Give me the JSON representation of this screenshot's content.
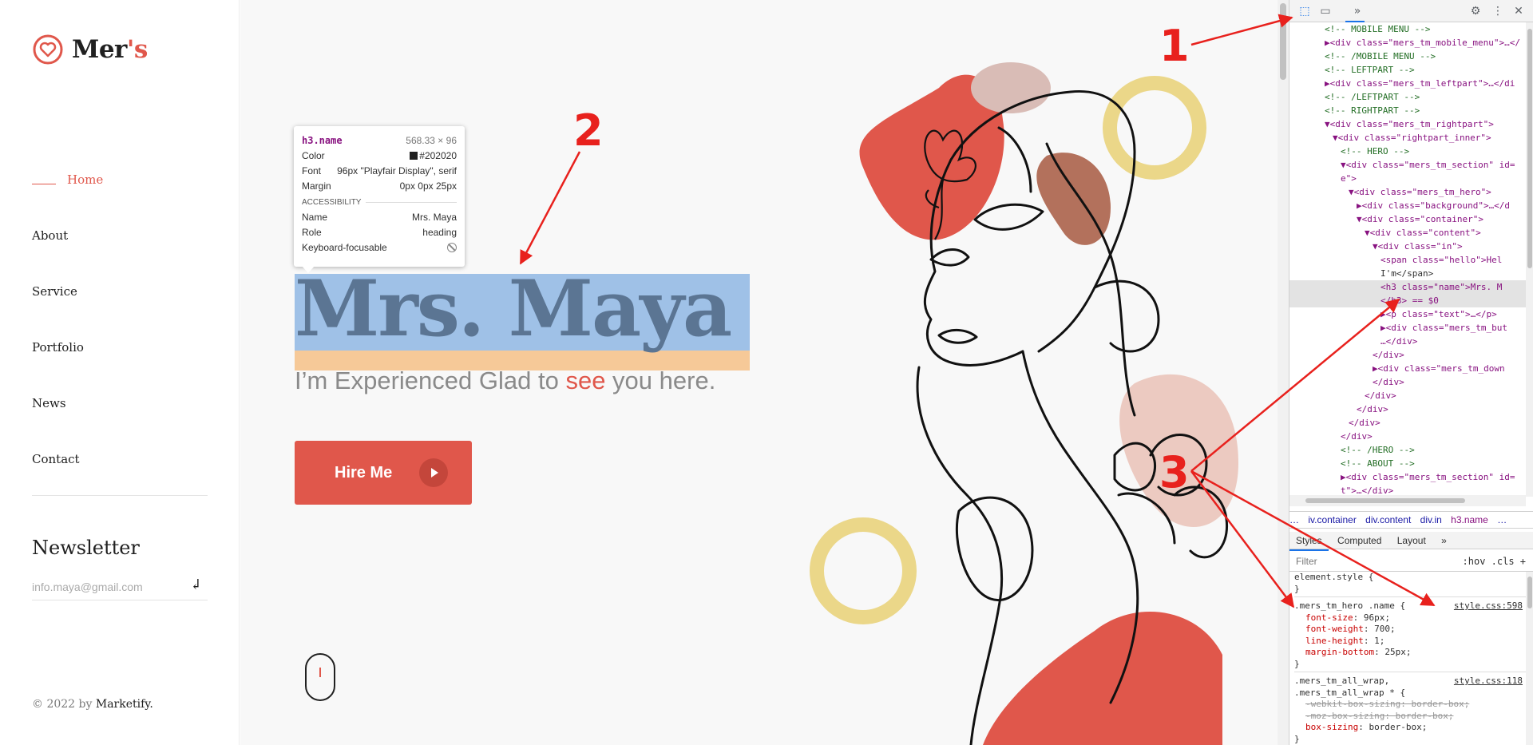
{
  "colors": {
    "accent": "#e0574b",
    "text": "#202020",
    "annotation": "#e8211d"
  },
  "sidebar": {
    "logo_text": "Mer",
    "logo_suffix": "'s",
    "logo_icon": "heart-badge-icon",
    "nav": [
      {
        "label": "Home",
        "active": true
      },
      {
        "label": "About"
      },
      {
        "label": "Service"
      },
      {
        "label": "Portfolio"
      },
      {
        "label": "News"
      },
      {
        "label": "Contact"
      }
    ],
    "newsletter_title": "Newsletter",
    "newsletter_placeholder": "info.maya@gmail.com",
    "newsletter_icon": "enter-return-icon",
    "copyright_prefix": "© 2022 by ",
    "copyright_brand": "Marketify."
  },
  "hero": {
    "name": "Mrs. Maya",
    "subtitle_before": "I’m Experienced Glad to ",
    "subtitle_highlight": "see",
    "subtitle_after": " you here.",
    "button_label": "Hire Me",
    "button_icon": "play-icon",
    "scroll_icon": "mouse-scroll-icon"
  },
  "tooltip": {
    "selector": "h3.name",
    "size": "568.33 × 96",
    "rows": [
      {
        "label": "Color",
        "value": "#202020"
      },
      {
        "label": "Font",
        "value": "96px \"Playfair Display\", serif"
      },
      {
        "label": "Margin",
        "value": "0px 0px 25px"
      }
    ],
    "section": "ACCESSIBILITY",
    "a11y": [
      {
        "label": "Name",
        "value": "Mrs. Maya"
      },
      {
        "label": "Role",
        "value": "heading"
      },
      {
        "label": "Keyboard-focusable",
        "value": ""
      }
    ]
  },
  "devtools": {
    "toolbar_icons": [
      "inspect-element-icon",
      "device-toolbar-icon",
      "more-panels-icon",
      "settings-gear-icon",
      "kebab-menu-icon",
      "close-icon"
    ],
    "dom": [
      {
        "indent": 0,
        "kind": "comment",
        "text": "<!-- MOBILE MENU -->"
      },
      {
        "indent": 0,
        "kind": "tag",
        "text": "▶<div class=\"mers_tm_mobile_menu\">…</"
      },
      {
        "indent": 0,
        "kind": "comment",
        "text": "<!-- /MOBILE MENU -->"
      },
      {
        "indent": 0,
        "kind": "comment",
        "text": "<!-- LEFTPART -->"
      },
      {
        "indent": 0,
        "kind": "tag",
        "text": "▶<div class=\"mers_tm_leftpart\">…</di"
      },
      {
        "indent": 0,
        "kind": "comment",
        "text": "<!-- /LEFTPART -->"
      },
      {
        "indent": 0,
        "kind": "comment",
        "text": "<!-- RIGHTPART -->"
      },
      {
        "indent": 0,
        "kind": "tag",
        "text": "▼<div class=\"mers_tm_rightpart\">"
      },
      {
        "indent": 1,
        "kind": "tag",
        "text": "▼<div class=\"rightpart_inner\">"
      },
      {
        "indent": 2,
        "kind": "comment",
        "text": "<!-- HERO -->"
      },
      {
        "indent": 2,
        "kind": "tag",
        "text": "▼<div class=\"mers_tm_section\" id="
      },
      {
        "indent": 2,
        "kind": "tag",
        "text": "e\">"
      },
      {
        "indent": 3,
        "kind": "tag",
        "text": "▼<div class=\"mers_tm_hero\">"
      },
      {
        "indent": 4,
        "kind": "tag",
        "text": "▶<div class=\"background\">…</d"
      },
      {
        "indent": 4,
        "kind": "tag",
        "text": "▼<div class=\"container\">"
      },
      {
        "indent": 5,
        "kind": "tag",
        "text": "▼<div class=\"content\">"
      },
      {
        "indent": 6,
        "kind": "tag",
        "text": "▼<div class=\"in\">"
      },
      {
        "indent": 7,
        "kind": "tag",
        "text": "<span class=\"hello\">Hel"
      },
      {
        "indent": 7,
        "kind": "plain",
        "text": "I'm</span>"
      },
      {
        "indent": 7,
        "kind": "tag",
        "text": "<h3 class=\"name\">Mrs. M",
        "selected": true
      },
      {
        "indent": 7,
        "kind": "tag",
        "text": "</h3> == $0",
        "selected": true
      },
      {
        "indent": 7,
        "kind": "tag",
        "text": "▶<p class=\"text\">…</p>"
      },
      {
        "indent": 7,
        "kind": "tag",
        "text": "▶<div class=\"mers_tm_but"
      },
      {
        "indent": 7,
        "kind": "tag",
        "text": "…</div>"
      },
      {
        "indent": 6,
        "kind": "tag",
        "text": "</div>"
      },
      {
        "indent": 6,
        "kind": "tag",
        "text": "▶<div class=\"mers_tm_down"
      },
      {
        "indent": 6,
        "kind": "tag",
        "text": "</div>"
      },
      {
        "indent": 5,
        "kind": "tag",
        "text": "</div>"
      },
      {
        "indent": 4,
        "kind": "tag",
        "text": "</div>"
      },
      {
        "indent": 3,
        "kind": "tag",
        "text": "</div>"
      },
      {
        "indent": 2,
        "kind": "tag",
        "text": "</div>"
      },
      {
        "indent": 2,
        "kind": "comment",
        "text": "<!-- /HERO -->"
      },
      {
        "indent": 2,
        "kind": "comment",
        "text": "<!-- ABOUT -->"
      },
      {
        "indent": 2,
        "kind": "tag",
        "text": "▶<div class=\"mers_tm_section\" id="
      },
      {
        "indent": 2,
        "kind": "tag",
        "text": "t\">…</div>"
      }
    ],
    "breadcrumbs": [
      "…",
      "iv.container",
      "div.content",
      "div.in",
      "h3.name",
      "…"
    ],
    "tabs": [
      "Styles",
      "Computed",
      "Layout",
      "»"
    ],
    "filter_placeholder": "Filter",
    "filter_right": ":hov  .cls  +",
    "styles": [
      {
        "selector": "element.style {",
        "source": "",
        "props": [],
        "close": "}"
      },
      {
        "selector": ".mers_tm_hero .name {",
        "source": "style.css:598",
        "props": [
          {
            "name": "font-size",
            "value": "96px;"
          },
          {
            "name": "font-weight",
            "value": "700;"
          },
          {
            "name": "line-height",
            "value": "1;"
          },
          {
            "name": "margin-bottom",
            "value": "25px;"
          }
        ],
        "close": "}"
      },
      {
        "selector": ".mers_tm_all_wrap,",
        "source": "style.css:118",
        "props": [],
        "close": ""
      },
      {
        "selector": ".mers_tm_all_wrap * {",
        "source": "",
        "props": [
          {
            "name": "-webkit-box-sizing",
            "value": "border-box;",
            "struck": true
          },
          {
            "name": "-moz-box-sizing",
            "value": "border-box;",
            "struck": true
          },
          {
            "name": "box-sizing",
            "value": "border-box;"
          }
        ],
        "close": "}"
      }
    ]
  },
  "annotations": {
    "one": "1",
    "two": "2",
    "three": "3"
  }
}
